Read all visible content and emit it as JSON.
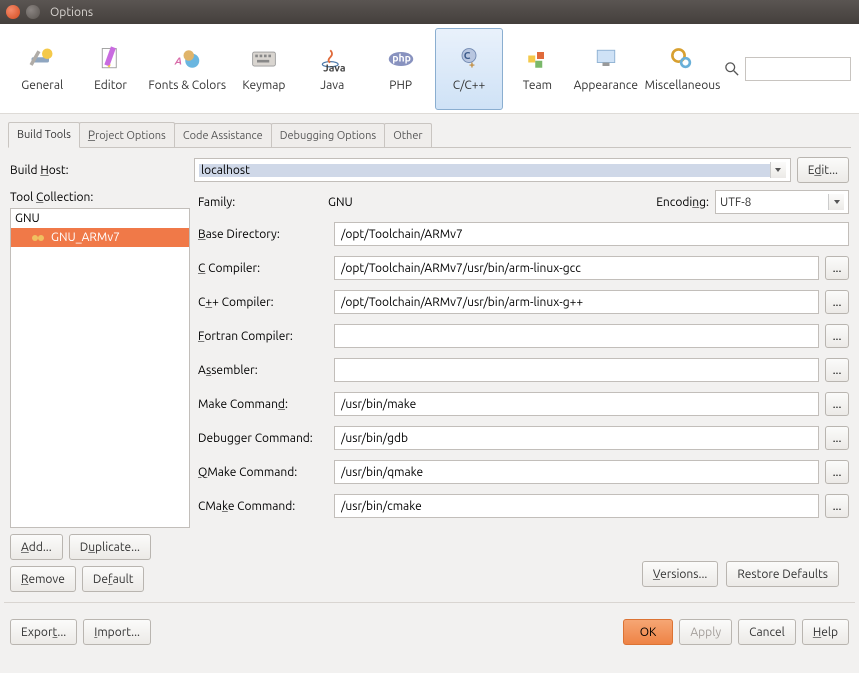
{
  "window": {
    "title": "Options"
  },
  "categories": [
    {
      "id": "general",
      "label": "General"
    },
    {
      "id": "editor",
      "label": "Editor"
    },
    {
      "id": "fonts",
      "label": "Fonts & Colors"
    },
    {
      "id": "keymap",
      "label": "Keymap"
    },
    {
      "id": "java",
      "label": "Java"
    },
    {
      "id": "php",
      "label": "PHP"
    },
    {
      "id": "cpp",
      "label": "C/C++"
    },
    {
      "id": "team",
      "label": "Team"
    },
    {
      "id": "appearance",
      "label": "Appearance"
    },
    {
      "id": "misc",
      "label": "Miscellaneous"
    }
  ],
  "tabs": {
    "build_tools": "Build Tools",
    "project_options": "Project Options",
    "code_assistance": "Code Assistance",
    "debugging_options": "Debugging Options",
    "other": "Other"
  },
  "labels": {
    "build_host": "Build Host:",
    "edit": "Edit...",
    "tool_collection": "Tool Collection:",
    "family": "Family:",
    "encoding": "Encoding:",
    "base_directory": "Base Directory:",
    "c_compiler": "C Compiler:",
    "cpp_compiler": "C++ Compiler:",
    "fortran_compiler": "Fortran Compiler:",
    "assembler": "Assembler:",
    "make_command": "Make Command:",
    "debugger_command": "Debugger Command:",
    "qmake_command": "QMake Command:",
    "cmake_command": "CMake Command:",
    "add": "Add...",
    "duplicate": "Duplicate...",
    "remove": "Remove",
    "default": "Default",
    "versions": "Versions...",
    "restore_defaults": "Restore Defaults",
    "export": "Export...",
    "import": "Import...",
    "ok": "OK",
    "apply": "Apply",
    "cancel": "Cancel",
    "help": "Help"
  },
  "values": {
    "build_host": "localhost",
    "family": "GNU",
    "encoding": "UTF-8",
    "base_directory": "/opt/Toolchain/ARMv7",
    "c_compiler": "/opt/Toolchain/ARMv7/usr/bin/arm-linux-gcc",
    "cpp_compiler": "/opt/Toolchain/ARMv7/usr/bin/arm-linux-g++",
    "fortran_compiler": "",
    "assembler": "",
    "make_command": "/usr/bin/make",
    "debugger_command": "/usr/bin/gdb",
    "qmake_command": "/usr/bin/qmake",
    "cmake_command": "/usr/bin/cmake"
  },
  "tree": {
    "root": "GNU",
    "selected": "GNU_ARMv7"
  }
}
